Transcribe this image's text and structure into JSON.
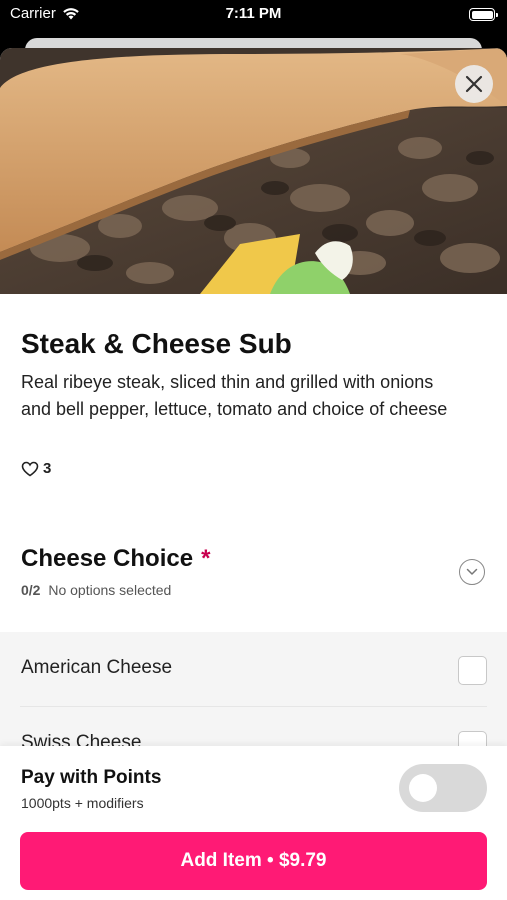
{
  "status_bar": {
    "carrier": "Carrier",
    "time": "7:11 PM"
  },
  "item": {
    "image_alt": "Steak & Cheese Sub photo",
    "title": "Steak & Cheese Sub",
    "description": "Real ribeye steak, sliced thin and grilled with onions and bell pepper, lettuce, tomato and choice of cheese",
    "likes": "3"
  },
  "modifier_group": {
    "title": "Cheese Choice",
    "required_mark": "*",
    "count": "0/2",
    "status": "No options selected",
    "options": [
      {
        "label": "American Cheese",
        "checked": false
      },
      {
        "label": "Swiss Cheese",
        "checked": false
      }
    ]
  },
  "footer": {
    "pay_with_points_title": "Pay with Points",
    "pay_with_points_sub": "1000pts + modifiers",
    "pay_with_points_enabled": false,
    "add_button_label": "Add Item • $9.79"
  },
  "colors": {
    "accent": "#ff1a75",
    "required": "#c8004e"
  }
}
